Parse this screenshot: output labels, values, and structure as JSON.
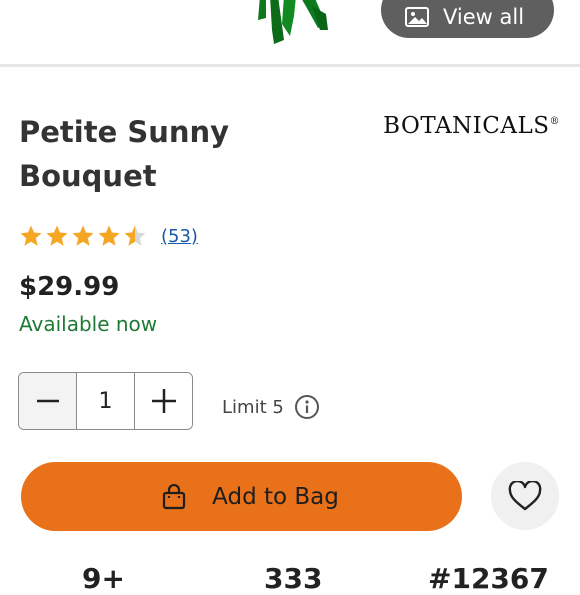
{
  "header": {
    "view_all_label": "View all"
  },
  "product": {
    "title_line1": "Petite Sunny",
    "title_line2": "Bouquet",
    "brand": "BOTANICALS",
    "brand_mark": "®",
    "rating": 4.5,
    "rating_max": 5,
    "review_count": "(53)",
    "price": "$29.99",
    "availability": "Available now"
  },
  "quantity": {
    "value": "1",
    "limit_label": "Limit 5"
  },
  "actions": {
    "add_to_bag_label": "Add to Bag"
  },
  "colors": {
    "accent": "#e8711a",
    "available": "#1f7a35",
    "link": "#1a5aa6",
    "star": "#f5a623"
  },
  "bottom_row": [
    "9+",
    "333",
    "#12367"
  ]
}
